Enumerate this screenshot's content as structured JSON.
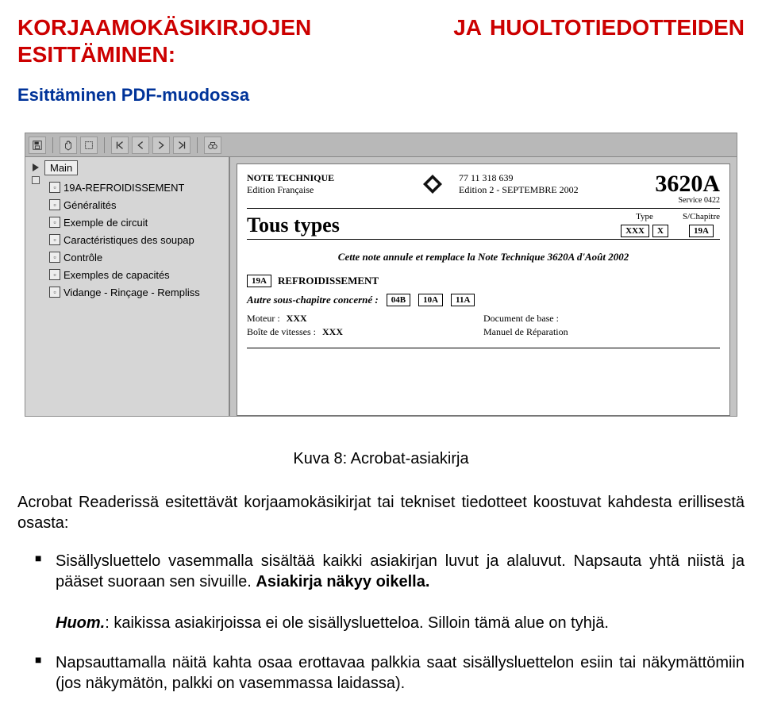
{
  "heading": {
    "word1": "KORJAAMOKÄSIKIRJOJEN",
    "word2": "JA",
    "word3": "HUOLTOTIEDOTTEIDEN",
    "line2": "ESITTÄMINEN:"
  },
  "subheading": "Esittäminen PDF-muodossa",
  "toolbar_icons": {
    "save": "save-icon",
    "hand": "hand-icon",
    "select": "select-icon",
    "first": "first-page-icon",
    "prev": "prev-page-icon",
    "next": "next-page-icon",
    "last": "last-page-icon",
    "binoculars": "binoculars-icon"
  },
  "nav": {
    "main": "Main",
    "section": "19A-REFROIDISSEMENT",
    "items": [
      "Généralités",
      "Exemple de circuit",
      "Caractéristiques des soupap",
      "Contrôle",
      "Exemples de capacités",
      "Vidange - Rinçage - Rempliss"
    ]
  },
  "doc": {
    "note_label": "NOTE TECHNIQUE",
    "edition_lang": "Edition Française",
    "ref_num": "77 11 318 639",
    "edition_date": "Edition 2 - SEPTEMBRE 2002",
    "big_num": "3620A",
    "service": "Service 0422",
    "type_label": "Type",
    "schapitre_label": "S/Chapitre",
    "title": "Tous types",
    "type_values": [
      "XXX",
      "X"
    ],
    "schapitre_value": "19A",
    "replace_note": "Cette note annule et remplace la Note Technique 3620A d'Août 2002",
    "section_code": "19A",
    "section_name": "REFROIDISSEMENT",
    "autre_label": "Autre sous-chapitre concerné :",
    "autre_codes": [
      "04B",
      "10A",
      "11A"
    ],
    "details_left": [
      {
        "k": "Moteur :",
        "v": "XXX"
      },
      {
        "k": "Boîte de vitesses :",
        "v": "XXX"
      }
    ],
    "details_right": [
      {
        "k": "Document de base :",
        "v": ""
      },
      {
        "k": "Manuel de Réparation",
        "v": ""
      }
    ]
  },
  "caption": "Kuva 8: Acrobat-asiakirja",
  "body": {
    "intro": "Acrobat Readerissä esitettävät korjaamokäsikirjat tai tekniset tiedotteet koostuvat kahdesta erillisestä osasta:",
    "b1a": "Sisällysluettelo vasemmalla sisältää kaikki asiakirjan luvut ja alaluvut. Napsauta yhtä niistä ja pääset suoraan sen sivuille. ",
    "b1b": "Asiakirja näkyy oikella.",
    "b1_note_prefix": "Huom.",
    "b1_note": ": kaikissa asiakirjoissa ei ole sisällysluetteloa. Silloin tämä alue on tyhjä.",
    "b2": "Napsauttamalla näitä kahta osaa erottavaa palkkia saat sisällysluettelon esiin tai näkymättömiin (jos näkymätön, palkki on vasemmassa laidassa)."
  }
}
